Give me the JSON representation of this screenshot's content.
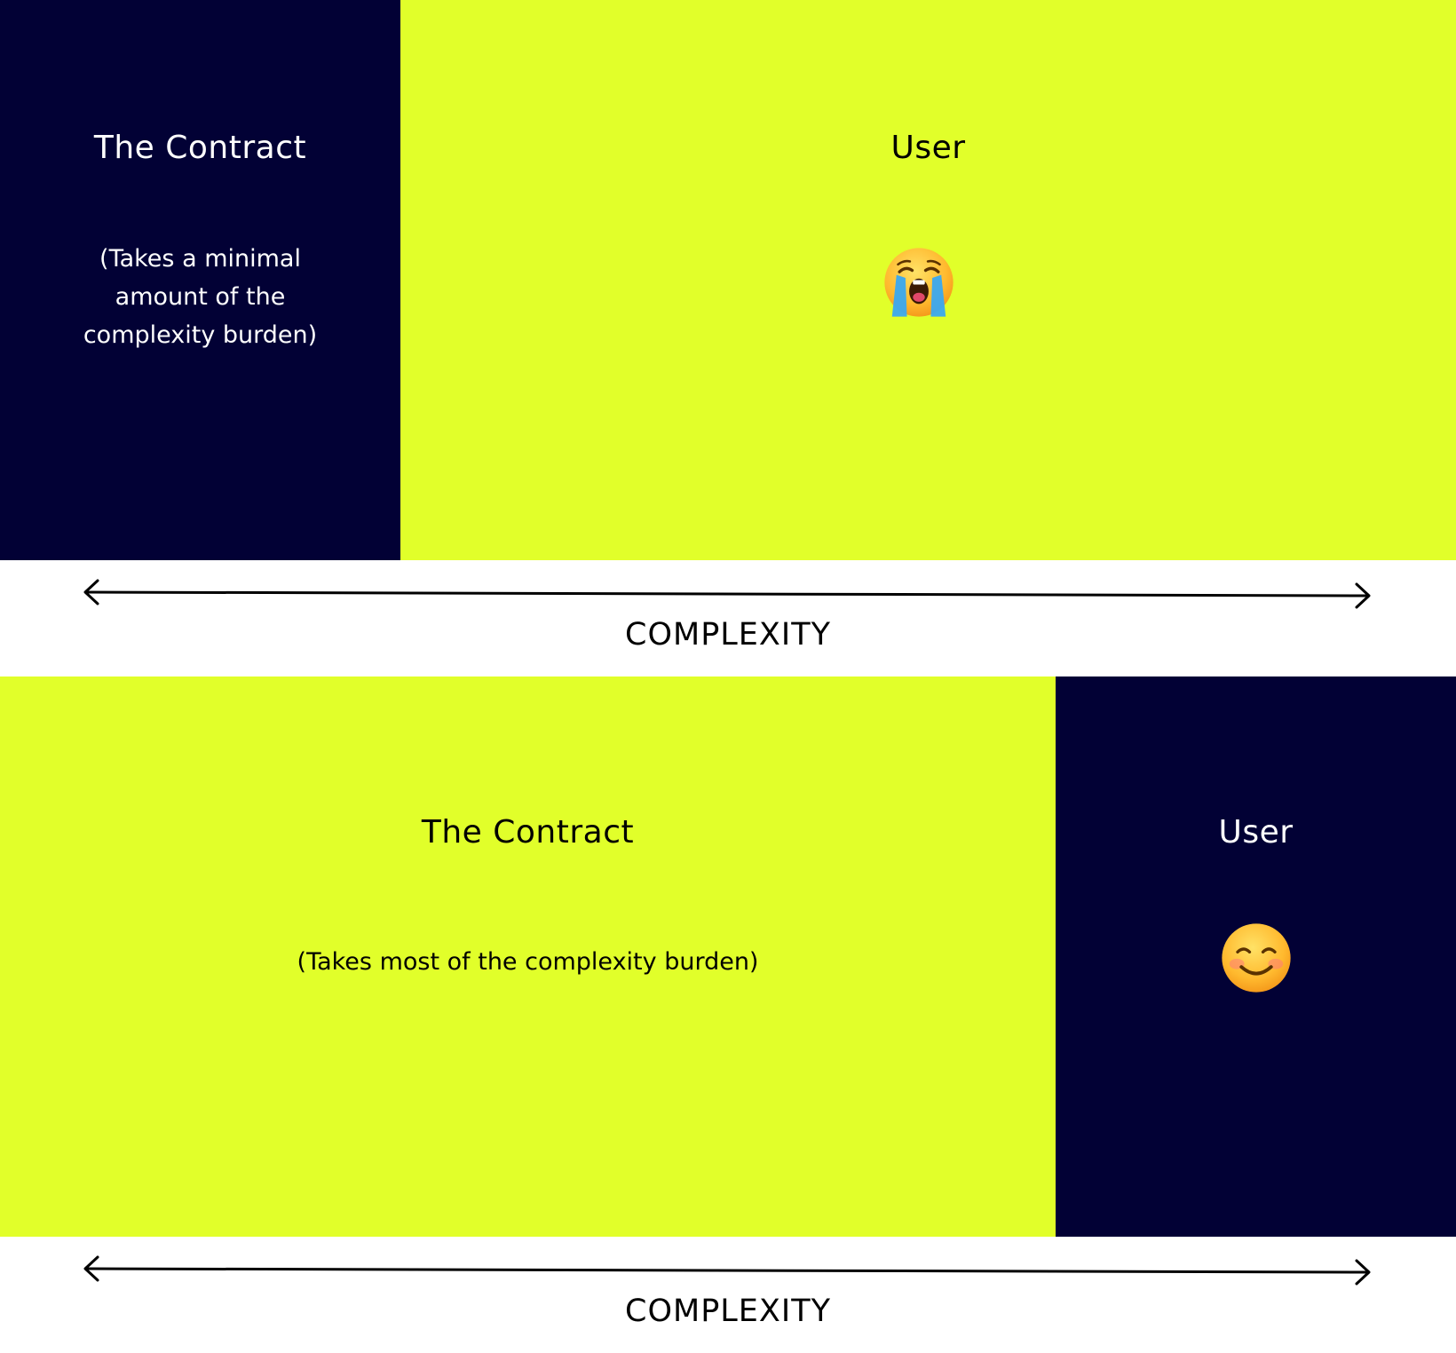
{
  "top": {
    "left_panel": {
      "title": "The Contract",
      "subtitle_lines": [
        "(Takes a minimal",
        "amount of the",
        "complexity burden)"
      ],
      "color": "#020135"
    },
    "right_panel": {
      "title": "User",
      "emoji": "loudly-crying-face-icon",
      "color": "#e1ff2a"
    },
    "axis_label": "COMPLEXITY"
  },
  "bottom": {
    "left_panel": {
      "title": "The Contract",
      "subtitle": "(Takes most of the complexity burden)",
      "color": "#e1ff2a"
    },
    "right_panel": {
      "title": "User",
      "emoji": "smiling-face-icon",
      "color": "#020135"
    },
    "axis_label": "COMPLEXITY"
  }
}
